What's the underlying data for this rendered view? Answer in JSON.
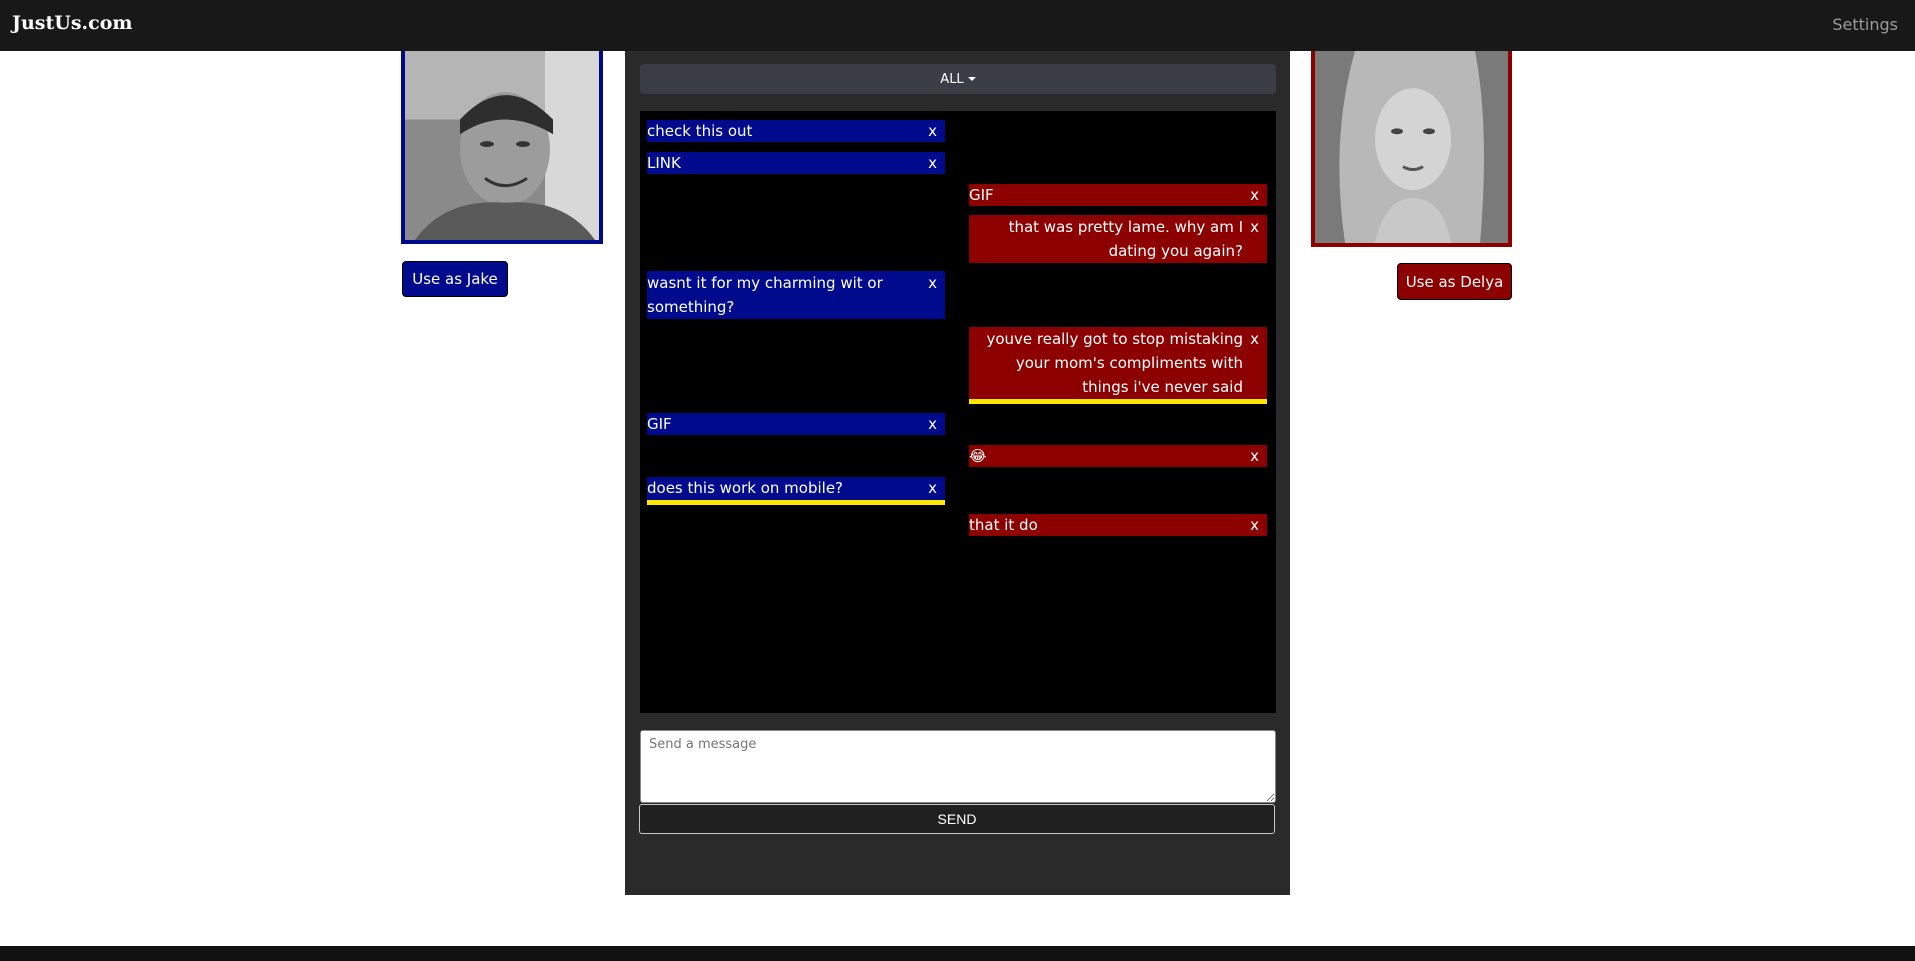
{
  "navbar": {
    "brand": "JustUs.com",
    "settings": "Settings"
  },
  "profiles": {
    "jake": {
      "button": "Use as Jake",
      "color": "#000a8c"
    },
    "delya": {
      "button": "Use as Delya",
      "color": "#8c0000"
    }
  },
  "filter": {
    "label": "ALL"
  },
  "messages": [
    {
      "sender": "jake",
      "text": "check this out",
      "delete": "x"
    },
    {
      "sender": "jake",
      "text": "LINK",
      "delete": "x"
    },
    {
      "sender": "delya",
      "text": "GIF",
      "delete": "x"
    },
    {
      "sender": "delya",
      "text": "that was pretty lame. why am I dating you again?",
      "delete": "x"
    },
    {
      "sender": "jake",
      "text": "wasnt it for my charming wit or something?",
      "delete": "x"
    },
    {
      "sender": "delya",
      "text": "youve really got to stop mistaking your mom's compliments with things i've never said",
      "delete": "x",
      "highlighted": true
    },
    {
      "sender": "jake",
      "text": "GIF",
      "delete": "x"
    },
    {
      "sender": "delya",
      "text": "😂",
      "delete": "x"
    },
    {
      "sender": "jake",
      "text": "does this work on mobile?",
      "delete": "x",
      "highlighted": true
    },
    {
      "sender": "delya",
      "text": "that it do",
      "delete": "x"
    }
  ],
  "composer": {
    "placeholder": "Send a message",
    "send_label": "SEND"
  },
  "colors": {
    "highlight": "#ffe600",
    "chat_bg": "#000000",
    "panel_bg": "#2a2a2a"
  }
}
